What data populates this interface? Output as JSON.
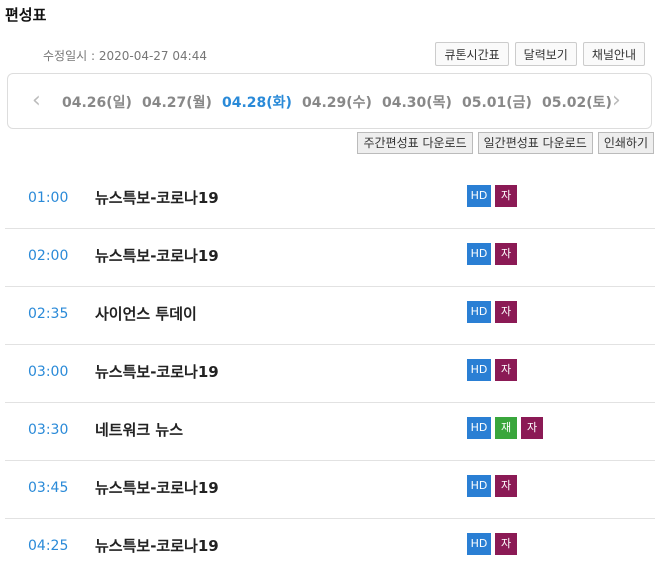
{
  "header": {
    "title": "편성표",
    "modified": "수정일시 : 2020-04-27 04:44"
  },
  "top_buttons": [
    "큐톤시간표",
    "달력보기",
    "채널안내"
  ],
  "dates": [
    {
      "label": "04.26(일)",
      "active": false
    },
    {
      "label": "04.27(월)",
      "active": false
    },
    {
      "label": "04.28(화)",
      "active": true
    },
    {
      "label": "04.29(수)",
      "active": false
    },
    {
      "label": "04.30(목)",
      "active": false
    },
    {
      "label": "05.01(금)",
      "active": false
    },
    {
      "label": "05.02(토)",
      "active": false
    }
  ],
  "nav": {
    "prev": "‹",
    "next": "›"
  },
  "download_buttons": [
    "주간편성표 다운로드",
    "일간편성표 다운로드",
    "인쇄하기"
  ],
  "schedule": [
    {
      "time": "01:00",
      "title": "뉴스특보-코로나19",
      "badges": [
        "HD",
        "자"
      ]
    },
    {
      "time": "02:00",
      "title": "뉴스특보-코로나19",
      "badges": [
        "HD",
        "자"
      ]
    },
    {
      "time": "02:35",
      "title": "사이언스 투데이",
      "badges": [
        "HD",
        "자"
      ]
    },
    {
      "time": "03:00",
      "title": "뉴스특보-코로나19",
      "badges": [
        "HD",
        "자"
      ]
    },
    {
      "time": "03:30",
      "title": "네트워크 뉴스",
      "badges": [
        "HD",
        "재",
        "자"
      ]
    },
    {
      "time": "03:45",
      "title": "뉴스특보-코로나19",
      "badges": [
        "HD",
        "자"
      ]
    },
    {
      "time": "04:25",
      "title": "뉴스특보-코로나19",
      "badges": [
        "HD",
        "자"
      ]
    }
  ],
  "colors": {
    "accent": "#2a8ad8",
    "hd": "#2a7fd4",
    "rerun": "#39a63c",
    "subtitle": "#8b1a55"
  }
}
